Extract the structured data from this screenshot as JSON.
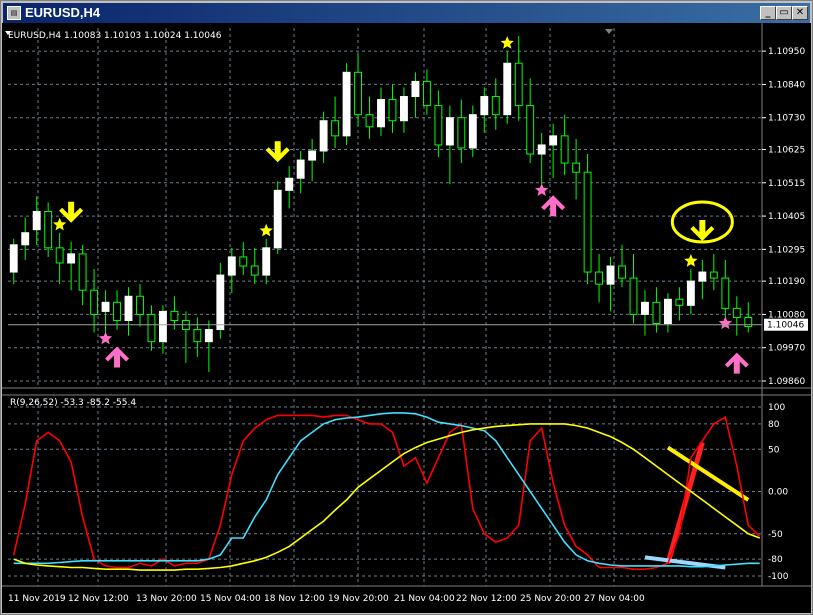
{
  "window": {
    "title": "EURUSD,H4",
    "icon": "chart-window-icon",
    "minimize": "minimize-icon",
    "restore": "restore-icon",
    "close": "close-icon"
  },
  "colors": {
    "bg": "#000000",
    "bull": "#ffffff",
    "wick": "#00ff00",
    "grid": "#6c7c8c",
    "red": "#ff0000",
    "cyan": "#40e0ff",
    "yellow": "#ffff00",
    "pink": "#ff6ec7",
    "drawRed": "#ff2020",
    "drawYellow": "#ffee00",
    "drawBlue": "#9fd8ff"
  },
  "chart_data": [
    {
      "type": "candlestick",
      "title": "EURUSD,H4  1.10083 1.10103 1.10024 1.10046",
      "ylim": [
        1.0986,
        1.11
      ],
      "yticks": [
        "1.10950",
        "1.10840",
        "1.10730",
        "1.10625",
        "1.10515",
        "1.10405",
        "1.10295",
        "1.10190",
        "1.10080",
        "1.09970",
        "1.09860"
      ],
      "current_price": "1.10046",
      "candles": [
        [
          1.1022,
          1.1033,
          1.1018,
          1.1031
        ],
        [
          1.1031,
          1.104,
          1.1026,
          1.1035
        ],
        [
          1.1036,
          1.1047,
          1.1031,
          1.1042
        ],
        [
          1.1042,
          1.1045,
          1.1027,
          1.103
        ],
        [
          1.103,
          1.1035,
          1.1018,
          1.1025
        ],
        [
          1.1025,
          1.1032,
          1.1016,
          1.1028
        ],
        [
          1.1028,
          1.1031,
          1.1011,
          1.1016
        ],
        [
          1.1016,
          1.1023,
          1.1002,
          1.1008
        ],
        [
          1.1009,
          1.1016,
          1.1002,
          1.1012
        ],
        [
          1.1012,
          1.1016,
          1.1003,
          1.1006
        ],
        [
          1.1006,
          1.1017,
          1.1001,
          1.1014
        ],
        [
          1.1014,
          1.1018,
          1.1004,
          1.1008
        ],
        [
          1.1008,
          1.1011,
          1.0996,
          1.0999
        ],
        [
          1.0999,
          1.1011,
          1.0995,
          1.1009
        ],
        [
          1.1009,
          1.1014,
          1.1003,
          1.1006
        ],
        [
          1.1006,
          1.1009,
          1.0992,
          1.1003
        ],
        [
          1.1003,
          1.1007,
          1.0994,
          1.0999
        ],
        [
          1.0999,
          1.1006,
          1.0989,
          1.1003
        ],
        [
          1.1003,
          1.1025,
          1.1,
          1.1021
        ],
        [
          1.1021,
          1.103,
          1.1015,
          1.1027
        ],
        [
          1.1027,
          1.1032,
          1.1021,
          1.1024
        ],
        [
          1.1024,
          1.103,
          1.1018,
          1.1021
        ],
        [
          1.1021,
          1.1033,
          1.1018,
          1.103
        ],
        [
          1.103,
          1.1052,
          1.1028,
          1.1049
        ],
        [
          1.1049,
          1.1057,
          1.1043,
          1.1053
        ],
        [
          1.1053,
          1.1062,
          1.1048,
          1.1059
        ],
        [
          1.1059,
          1.1066,
          1.1052,
          1.1062
        ],
        [
          1.1062,
          1.1075,
          1.1058,
          1.1072
        ],
        [
          1.1072,
          1.108,
          1.1063,
          1.1067
        ],
        [
          1.1067,
          1.1091,
          1.1064,
          1.1088
        ],
        [
          1.1088,
          1.1094,
          1.107,
          1.1074
        ],
        [
          1.1074,
          1.108,
          1.1066,
          1.107
        ],
        [
          1.107,
          1.1083,
          1.1067,
          1.1079
        ],
        [
          1.1079,
          1.1084,
          1.1068,
          1.1072
        ],
        [
          1.1072,
          1.1083,
          1.1068,
          1.108
        ],
        [
          1.108,
          1.1088,
          1.1073,
          1.1085
        ],
        [
          1.1085,
          1.1089,
          1.1074,
          1.1077
        ],
        [
          1.1077,
          1.1082,
          1.106,
          1.1064
        ],
        [
          1.1064,
          1.1077,
          1.1051,
          1.1073
        ],
        [
          1.1073,
          1.1079,
          1.1058,
          1.1063
        ],
        [
          1.1063,
          1.1077,
          1.106,
          1.1074
        ],
        [
          1.1074,
          1.1083,
          1.1068,
          1.108
        ],
        [
          1.108,
          1.1086,
          1.1069,
          1.1074
        ],
        [
          1.1074,
          1.1095,
          1.1071,
          1.1091
        ],
        [
          1.1091,
          1.11,
          1.1072,
          1.1077
        ],
        [
          1.1077,
          1.1086,
          1.1058,
          1.1061
        ],
        [
          1.1061,
          1.1068,
          1.1051,
          1.1064
        ],
        [
          1.1064,
          1.1071,
          1.1053,
          1.1067
        ],
        [
          1.1067,
          1.1074,
          1.1054,
          1.1058
        ],
        [
          1.1058,
          1.1066,
          1.1046,
          1.1055
        ],
        [
          1.1055,
          1.1061,
          1.1018,
          1.1022
        ],
        [
          1.1022,
          1.1028,
          1.1012,
          1.1018
        ],
        [
          1.1018,
          1.1027,
          1.1009,
          1.1024
        ],
        [
          1.1024,
          1.1031,
          1.1017,
          1.102
        ],
        [
          1.102,
          1.1028,
          1.1005,
          1.1008
        ],
        [
          1.1008,
          1.1016,
          1.1001,
          1.1012
        ],
        [
          1.1012,
          1.1017,
          1.1002,
          1.1005
        ],
        [
          1.1005,
          1.1015,
          1.1002,
          1.1013
        ],
        [
          1.1013,
          1.1017,
          1.1006,
          1.1011
        ],
        [
          1.1011,
          1.1023,
          1.1008,
          1.1019
        ],
        [
          1.1019,
          1.1026,
          1.1013,
          1.1022
        ],
        [
          1.1022,
          1.1028,
          1.1016,
          1.102
        ],
        [
          1.102,
          1.1026,
          1.1007,
          1.101
        ],
        [
          1.101,
          1.1014,
          1.1001,
          1.1007
        ],
        [
          1.1007,
          1.1012,
          1.1002,
          1.1004
        ]
      ],
      "markers": {
        "down_arrows": [
          5,
          23,
          44,
          60
        ],
        "up_arrows": [
          9,
          47,
          63
        ],
        "yellow_stars": [
          4,
          22,
          43,
          59
        ],
        "pink_stars": [
          8,
          46,
          62
        ],
        "circle_at": 60
      }
    },
    {
      "type": "line",
      "title": "R(9,26,52) -53.3 -85.2 -55.4",
      "ylim": [
        -100,
        100
      ],
      "yticks": [
        "100",
        "80",
        "50",
        "0.00",
        "-50",
        "-80",
        "-100"
      ],
      "series": [
        {
          "color": "red",
          "values": [
            -75,
            -15,
            60,
            70,
            60,
            35,
            -30,
            -80,
            -88,
            -90,
            -90,
            -85,
            -88,
            -80,
            -88,
            -85,
            -85,
            -80,
            -40,
            20,
            60,
            75,
            85,
            90,
            90,
            90,
            90,
            88,
            90,
            90,
            85,
            80,
            80,
            70,
            30,
            40,
            10,
            40,
            70,
            80,
            -20,
            -50,
            -60,
            -55,
            -40,
            60,
            75,
            10,
            -40,
            -65,
            -75,
            -90,
            -90,
            -90,
            -92,
            -92,
            -90,
            -85,
            -50,
            40,
            60,
            80,
            88,
            30,
            -40,
            -53
          ]
        },
        {
          "color": "cyan",
          "values": [
            -85,
            -85,
            -85,
            -85,
            -84,
            -83,
            -82,
            -82,
            -82,
            -82,
            -82,
            -82,
            -82,
            -82,
            -82,
            -82,
            -82,
            -80,
            -75,
            -55,
            -55,
            -30,
            -10,
            20,
            40,
            60,
            70,
            80,
            85,
            87,
            88,
            90,
            92,
            93,
            93,
            92,
            88,
            82,
            80,
            78,
            75,
            72,
            60,
            40,
            20,
            0,
            -20,
            -40,
            -60,
            -75,
            -82,
            -85,
            -87,
            -88,
            -88,
            -88,
            -88,
            -88,
            -88,
            -89,
            -89,
            -88,
            -87,
            -86,
            -85,
            -85
          ]
        },
        {
          "color": "yellow",
          "values": [
            -80,
            -85,
            -87,
            -88,
            -89,
            -90,
            -90,
            -91,
            -92,
            -92,
            -92,
            -93,
            -93,
            -93,
            -93,
            -92,
            -92,
            -91,
            -90,
            -88,
            -85,
            -82,
            -78,
            -72,
            -65,
            -55,
            -45,
            -35,
            -22,
            -10,
            5,
            15,
            25,
            35,
            45,
            52,
            58,
            62,
            66,
            70,
            73,
            75,
            77,
            78,
            79,
            80,
            80,
            80,
            80,
            78,
            75,
            70,
            65,
            58,
            50,
            40,
            30,
            20,
            10,
            0,
            -10,
            -20,
            -30,
            -40,
            -50,
            -55
          ]
        }
      ]
    }
  ],
  "xticks": [
    "11 Nov 2019",
    "12 Nov 12:00",
    "13 Nov 20:00",
    "15 Nov 04:00",
    "18 Nov 12:00",
    "19 Nov 20:00",
    "21 Nov 04:00",
    "22 Nov 12:00",
    "25 Nov 20:00",
    "27 Nov 04:00"
  ]
}
